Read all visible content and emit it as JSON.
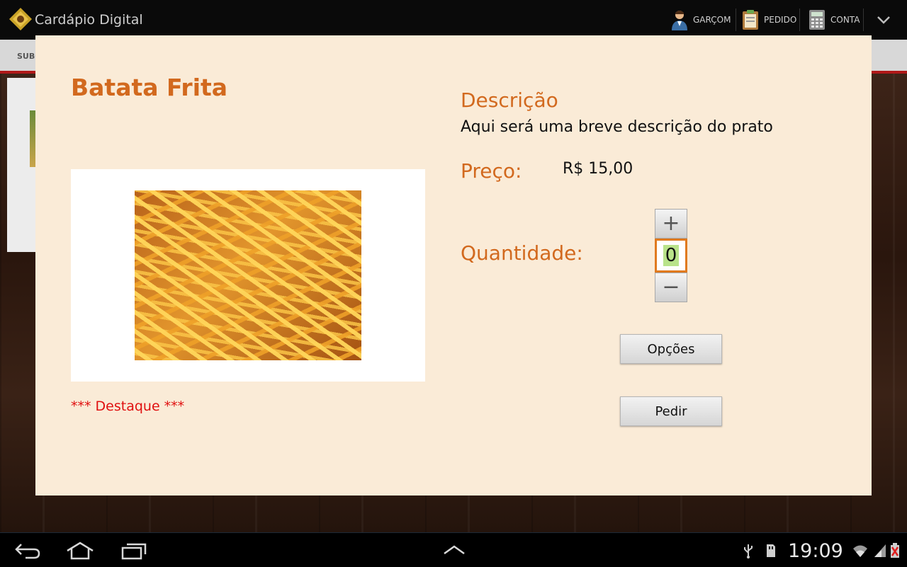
{
  "app": {
    "title": "Cardápio Digital",
    "actions": [
      {
        "label": "GARÇOM",
        "icon": "waiter-icon"
      },
      {
        "label": "PEDIDO",
        "icon": "order-clipboard-icon"
      },
      {
        "label": "CONTA",
        "icon": "calculator-icon"
      }
    ],
    "overflow_icon": "chevron-down-icon"
  },
  "subbar": {
    "label": "SUBC"
  },
  "dialog": {
    "title": "Batata Frita",
    "image_icon": "french-fries-photo",
    "highlight": "*** Destaque ***",
    "description_label": "Descrição",
    "description_text": "Aqui será uma breve descrição do prato",
    "price_label": "Preço:",
    "price_value": "R$ 15,00",
    "quantity_label": "Quantidade:",
    "quantity_value": "0",
    "quantity_increment": "+",
    "quantity_decrement": "−",
    "options_button": "Opções",
    "order_button": "Pedir"
  },
  "system_bar": {
    "time": "19:09",
    "nav_icons": [
      "back-icon",
      "home-icon",
      "recent-apps-icon",
      "up-chevron-icon"
    ],
    "status_icons": [
      "usb-icon",
      "sd-card-icon",
      "wifi-icon",
      "signal-icon",
      "battery-alert-icon"
    ]
  },
  "colors": {
    "accent": "#d2691e",
    "dialog_background": "#faebd7",
    "highlight_text": "#e01010",
    "stepper_focus": "#e07a1f"
  }
}
